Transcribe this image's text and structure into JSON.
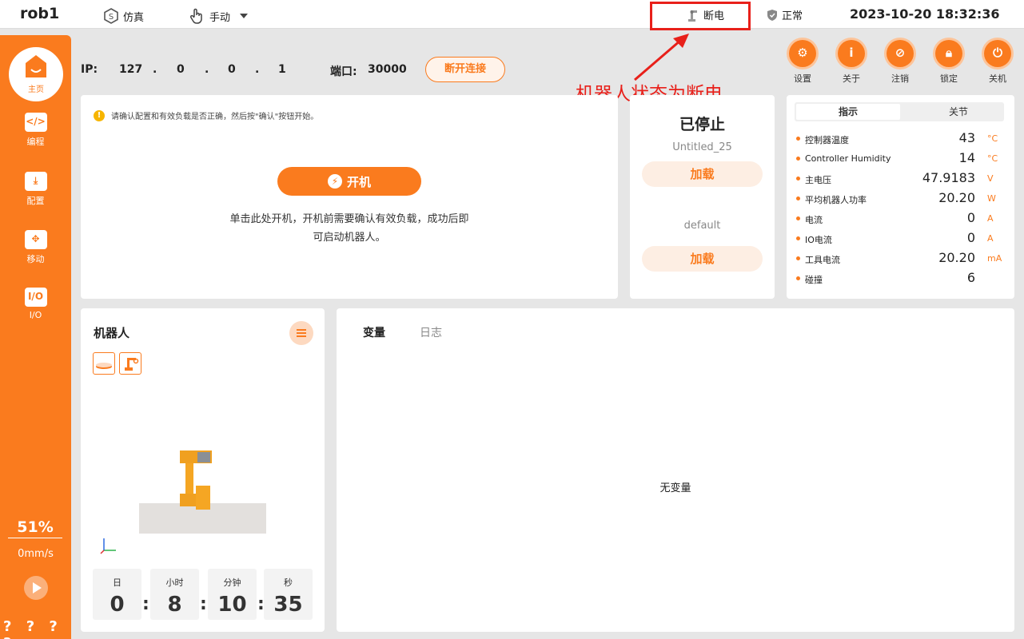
{
  "topbar": {
    "robot_name": "rob1",
    "sim_label": "仿真",
    "mode_label": "手动",
    "power_label": "断电",
    "status_label": "正常",
    "datetime": "2023-10-20 18:32:36"
  },
  "annotation": {
    "text": "机器人状态为断电"
  },
  "sidebar": {
    "items": [
      {
        "label": "主页",
        "icon": "home-icon"
      },
      {
        "label": "编程",
        "icon": "code-icon"
      },
      {
        "label": "配置",
        "icon": "config-icon"
      },
      {
        "label": "移动",
        "icon": "move-icon"
      },
      {
        "label": "I/O",
        "icon": "io-icon"
      }
    ],
    "speed_percent": "51%",
    "speed_value": "0mm/s",
    "help": "? ? ? ?"
  },
  "connection": {
    "ip_label": "IP:",
    "ip": [
      "127",
      "0",
      "0",
      "1"
    ],
    "ip_dot": ".",
    "port_label": "端口:",
    "port": "30000",
    "disconnect_label": "断开连接"
  },
  "tools": [
    {
      "label": "设置",
      "icon": "gear-icon"
    },
    {
      "label": "关于",
      "icon": "info-icon"
    },
    {
      "label": "注销",
      "icon": "logout-icon"
    },
    {
      "label": "锁定",
      "icon": "lock-icon"
    },
    {
      "label": "关机",
      "icon": "power-icon"
    }
  ],
  "main": {
    "hint": "请确认配置和有效负载是否正确，然后按\"确认\"按钮开始。",
    "power_on_label": "开机",
    "power_desc": "单击此处开机，开机前需要确认有效负载，成功后即可启动机器人。"
  },
  "program": {
    "state": "已停止",
    "program_name": "Untitled_25",
    "load_label_1": "加载",
    "config_name": "default",
    "load_label_2": "加载"
  },
  "indicators": {
    "tabs": [
      "指示",
      "关节"
    ],
    "rows": [
      {
        "label": "控制器温度",
        "value": "43",
        "unit": "°C"
      },
      {
        "label": "Controller Humidity",
        "value": "14",
        "unit": "°C"
      },
      {
        "label": "主电压",
        "value": "47.9183",
        "unit": "V"
      },
      {
        "label": "平均机器人功率",
        "value": "20.20",
        "unit": "W"
      },
      {
        "label": "电流",
        "value": "0",
        "unit": "A"
      },
      {
        "label": "IO电流",
        "value": "0",
        "unit": "A"
      },
      {
        "label": "工具电流",
        "value": "20.20",
        "unit": "mA"
      },
      {
        "label": "碰撞",
        "value": "6",
        "unit": ""
      }
    ]
  },
  "robot_panel": {
    "title": "机器人",
    "timer": [
      {
        "label": "日",
        "value": "0"
      },
      {
        "label": "小时",
        "value": "8"
      },
      {
        "label": "分钟",
        "value": "10"
      },
      {
        "label": "秒",
        "value": "35"
      }
    ],
    "colon": ":"
  },
  "variables": {
    "tabs": [
      "变量",
      "日志"
    ],
    "empty_text": "无变量"
  },
  "colors": {
    "accent": "#fa7b1e",
    "alert": "#e8201a"
  }
}
